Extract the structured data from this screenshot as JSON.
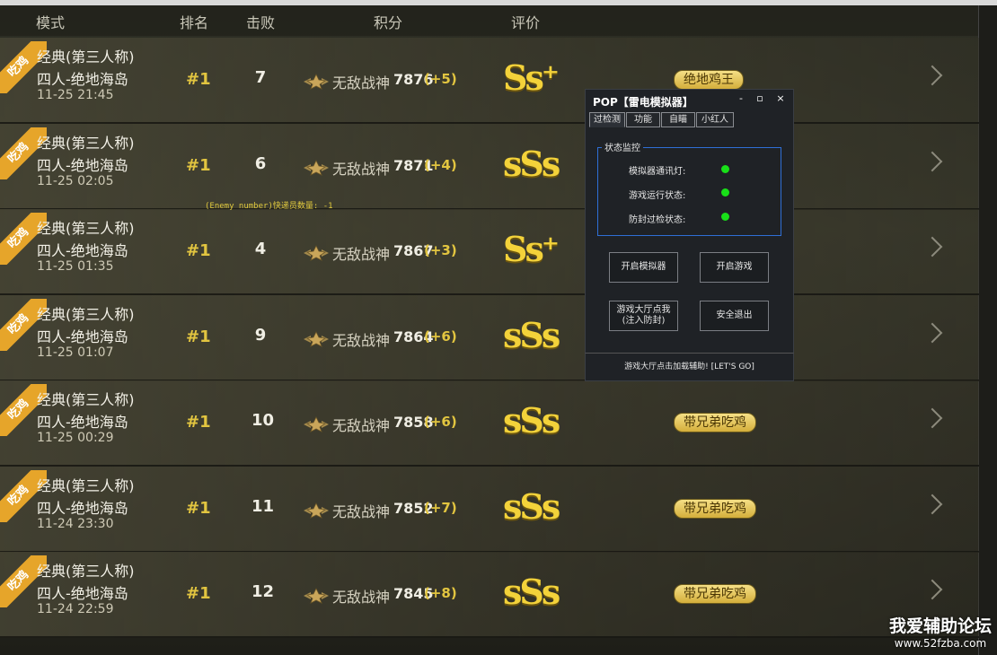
{
  "header": {
    "mode": "模式",
    "rank": "排名",
    "kills": "击败",
    "score": "积分",
    "rating": "评价"
  },
  "rows": [
    {
      "ribbon": "吃鸡",
      "mode": "经典(第三人称)",
      "map": "四人-绝地海岛",
      "time": "11-25 21:45",
      "rank": "#1",
      "kills": "7",
      "title": "无敌战神",
      "score": "7876",
      "delta": "(+5)",
      "grade": "Ss⁺",
      "badge": "绝地鸡王"
    },
    {
      "ribbon": "吃鸡",
      "mode": "经典(第三人称)",
      "map": "四人-绝地海岛",
      "time": "11-25 02:05",
      "rank": "#1",
      "kills": "6",
      "title": "无敌战神",
      "score": "7871",
      "delta": "(+4)",
      "grade": "sSs",
      "badge": ""
    },
    {
      "ribbon": "吃鸡",
      "mode": "经典(第三人称)",
      "map": "四人-绝地海岛",
      "time": "11-25 01:35",
      "rank": "#1",
      "kills": "4",
      "title": "无敌战神",
      "score": "7867",
      "delta": "(+3)",
      "grade": "Ss⁺",
      "badge": ""
    },
    {
      "ribbon": "吃鸡",
      "mode": "经典(第三人称)",
      "map": "四人-绝地海岛",
      "time": "11-25 01:07",
      "rank": "#1",
      "kills": "9",
      "title": "无敌战神",
      "score": "7864",
      "delta": "(+6)",
      "grade": "sSs",
      "badge": ""
    },
    {
      "ribbon": "吃鸡",
      "mode": "经典(第三人称)",
      "map": "四人-绝地海岛",
      "time": "11-25 00:29",
      "rank": "#1",
      "kills": "10",
      "title": "无敌战神",
      "score": "7858",
      "delta": "(+6)",
      "grade": "sSs",
      "badge": "带兄弟吃鸡"
    },
    {
      "ribbon": "吃鸡",
      "mode": "经典(第三人称)",
      "map": "四人-绝地海岛",
      "time": "11-24 23:30",
      "rank": "#1",
      "kills": "11",
      "title": "无敌战神",
      "score": "7852",
      "delta": "(+7)",
      "grade": "sSs",
      "badge": "带兄弟吃鸡"
    },
    {
      "ribbon": "吃鸡",
      "mode": "经典(第三人称)",
      "map": "四人-绝地海岛",
      "time": "11-24 22:59",
      "rank": "#1",
      "kills": "12",
      "title": "无敌战神",
      "score": "7845",
      "delta": "(+8)",
      "grade": "sSs",
      "badge": "带兄弟吃鸡"
    }
  ],
  "overlay_text": "(Enemy number)快递员数量: -1",
  "dialog": {
    "title": "POP【雷电模拟器】",
    "minimize": "-",
    "maximize": "▫",
    "close": "×",
    "tabs": [
      "过检测",
      "功能",
      "自瞄",
      "小红人"
    ],
    "group_label": "状态监控",
    "statuses": [
      "模拟器通讯灯:",
      "游戏运行状态:",
      "防封过检状态:"
    ],
    "buttons": {
      "start_emulator": "开启模拟器",
      "start_game": "开启游戏",
      "lobby_line1": "游戏大厅点我",
      "lobby_line2": "(注入防封)",
      "safe_exit": "安全退出"
    },
    "footer": "游戏大厅点击加载辅助! [LET'S GO]"
  },
  "watermark": {
    "line1": "我爱辅助论坛",
    "line2": "www.52fzba.com"
  }
}
